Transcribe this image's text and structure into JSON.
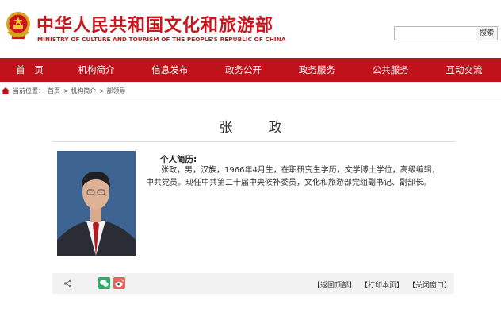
{
  "header": {
    "title": "中华人民共和国文化和旅游部",
    "subtitle": "MINISTRY OF CULTURE AND TOURISM OF THE PEOPLE'S REPUBLIC OF CHINA",
    "search_value": "",
    "search_button": "搜索",
    "emblem_icon": "national-emblem-icon",
    "brand_color": "#c8161d"
  },
  "nav": {
    "color": "#c0121a",
    "items": [
      "首　页",
      "机构简介",
      "信息发布",
      "政务公开",
      "政务服务",
      "公共服务",
      "互动交流"
    ]
  },
  "breadcrumb": {
    "prefix": "当前位置：",
    "items": [
      "首页",
      "> 机构简介",
      "> 部领导"
    ]
  },
  "profile": {
    "name": "张　政",
    "bio_heading": "个人简历:",
    "bio_text": "张政，男，汉族，1966年4月生，在职研究生学历，文学博士学位，高级编辑，中共党员。现任中共第二十届中央候补委员，文化和旅游部党组副书记、副部长。",
    "photo": "portrait-photo"
  },
  "footer": {
    "share_icon": "share-icon",
    "wechat_icon": "wechat-icon",
    "weibo_icon": "weibo-icon",
    "links": [
      "【返回顶部】",
      "【打印本页】",
      "【关闭窗口】"
    ]
  }
}
